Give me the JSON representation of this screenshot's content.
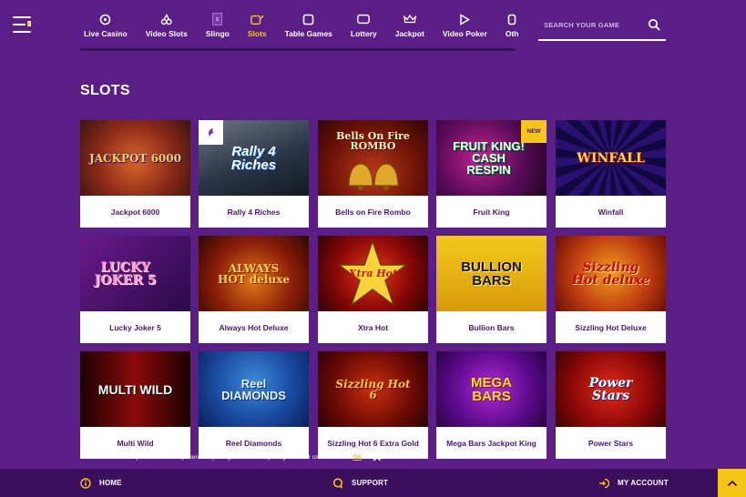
{
  "nav": {
    "items": [
      {
        "label": "Live Casino",
        "icon": "roulette-icon",
        "active": false
      },
      {
        "label": "Video Slots",
        "icon": "cherries-icon",
        "active": false
      },
      {
        "label": "Slingo",
        "icon": "slingo-card-icon",
        "active": false
      },
      {
        "label": "Slots",
        "icon": "slot-machine-icon",
        "active": true
      },
      {
        "label": "Table Games",
        "icon": "cards-icon",
        "active": false
      },
      {
        "label": "Lottery",
        "icon": "lottery-ticket-icon",
        "active": false
      },
      {
        "label": "Jackpot",
        "icon": "crown-icon",
        "active": false
      },
      {
        "label": "Video Poker",
        "icon": "play-icon",
        "active": false
      },
      {
        "label": "Oth",
        "icon": "other-icon",
        "active": false
      }
    ]
  },
  "search": {
    "placeholder": "SEARCH YOUR GAME",
    "value": ""
  },
  "section": {
    "title": "SLOTS"
  },
  "games": [
    {
      "title": "Jackpot 6000",
      "logo": "JACKPOT 6000"
    },
    {
      "title": "Rally 4 Riches",
      "logo": "Rally 4 Riches"
    },
    {
      "title": "Bells on Fire Rombo",
      "logo": "Bells On Fire ROMBO"
    },
    {
      "title": "Fruit King",
      "logo": "FRUIT KING! CASH RESPIN",
      "badge": "NEW"
    },
    {
      "title": "Winfall",
      "logo": "WINFALL"
    },
    {
      "title": "Lucky Joker 5",
      "logo": "LUCKY JOKER 5"
    },
    {
      "title": "Always Hot Deluxe",
      "logo": "ALWAYS HOT deluxe"
    },
    {
      "title": "Xtra Hot",
      "logo": "Xtra Hot"
    },
    {
      "title": "Bullion Bars",
      "logo": "BULLION BARS"
    },
    {
      "title": "Sizzling Hot Deluxe",
      "logo": "Sizzling Hot deluxe"
    },
    {
      "title": "Multi Wild",
      "logo": "MULTI WILD"
    },
    {
      "title": "Reel Diamonds",
      "logo": "Reel DIAMONDS"
    },
    {
      "title": "Sizzling Hot 6 Extra Gold",
      "logo": "Sizzling Hot 6"
    },
    {
      "title": "Mega Bars Jackpot King",
      "logo": "MEGA BARS"
    },
    {
      "title": "Power Stars",
      "logo": "Power Stars"
    }
  ],
  "cookie": {
    "text": "We use cookies to improve the user experience. By using our services, you agree to our use of cookies.",
    "ok": "OK"
  },
  "bottom": {
    "home": "HOME",
    "support": "SUPPORT",
    "account": "MY ACCOUNT"
  },
  "colors": {
    "background": "#5b1e86",
    "accent": "#f5c518",
    "card_title": "#4a1670",
    "bottom_bar": "#3b0f5c"
  }
}
